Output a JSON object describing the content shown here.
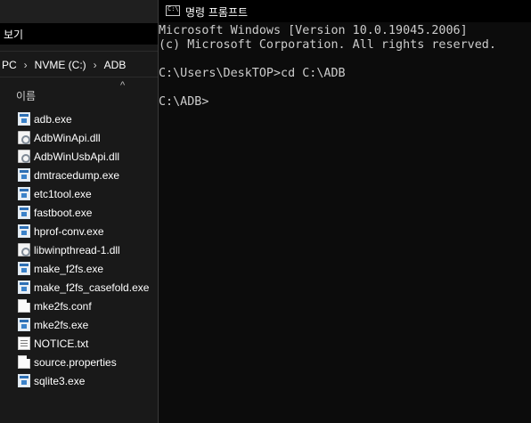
{
  "explorer": {
    "ribbon_tab": "보기",
    "address": {
      "segments": [
        "PC",
        "NVME (C:)",
        "ADB"
      ]
    },
    "column_header": {
      "name": "이름",
      "sort_glyph": "^"
    },
    "files": [
      {
        "name": "adb.exe",
        "icon": "exe-icon"
      },
      {
        "name": "AdbWinApi.dll",
        "icon": "dll-icon"
      },
      {
        "name": "AdbWinUsbApi.dll",
        "icon": "dll-icon"
      },
      {
        "name": "dmtracedump.exe",
        "icon": "exe-icon"
      },
      {
        "name": "etc1tool.exe",
        "icon": "exe-icon"
      },
      {
        "name": "fastboot.exe",
        "icon": "exe-icon"
      },
      {
        "name": "hprof-conv.exe",
        "icon": "exe-icon"
      },
      {
        "name": "libwinpthread-1.dll",
        "icon": "dll-icon"
      },
      {
        "name": "make_f2fs.exe",
        "icon": "exe-icon"
      },
      {
        "name": "make_f2fs_casefold.exe",
        "icon": "exe-icon"
      },
      {
        "name": "mke2fs.conf",
        "icon": "doc-icon"
      },
      {
        "name": "mke2fs.exe",
        "icon": "exe-icon"
      },
      {
        "name": "NOTICE.txt",
        "icon": "txt-icon"
      },
      {
        "name": "source.properties",
        "icon": "doc-icon"
      },
      {
        "name": "sqlite3.exe",
        "icon": "exe-icon"
      }
    ]
  },
  "console": {
    "title": "명령 프롬프트",
    "icon_text": "C:\\",
    "lines": [
      "Microsoft Windows [Version 10.0.19045.2006]",
      "(c) Microsoft Corporation. All rights reserved.",
      "",
      "C:\\Users\\DeskTOP>cd C:\\ADB",
      "",
      "C:\\ADB>"
    ]
  }
}
